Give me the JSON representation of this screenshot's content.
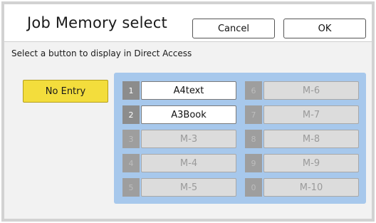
{
  "title": "Job Memory select",
  "buttons": {
    "cancel": "Cancel",
    "ok": "OK"
  },
  "instruction": "Select a button to display in Direct Access",
  "no_entry": "No Entry",
  "slots": [
    {
      "num": "1",
      "name": "A4text",
      "active": true
    },
    {
      "num": "2",
      "name": "A3Book",
      "active": true
    },
    {
      "num": "3",
      "name": "M-3",
      "active": false
    },
    {
      "num": "4",
      "name": "M-4",
      "active": false
    },
    {
      "num": "5",
      "name": "M-5",
      "active": false
    },
    {
      "num": "6",
      "name": "M-6",
      "active": false
    },
    {
      "num": "7",
      "name": "M-7",
      "active": false
    },
    {
      "num": "8",
      "name": "M-8",
      "active": false
    },
    {
      "num": "9",
      "name": "M-9",
      "active": false
    },
    {
      "num": "0",
      "name": "M-10",
      "active": false
    }
  ],
  "colors": {
    "no_entry_bg": "#f3dd3c",
    "panel_bg": "#a7c8ec"
  }
}
